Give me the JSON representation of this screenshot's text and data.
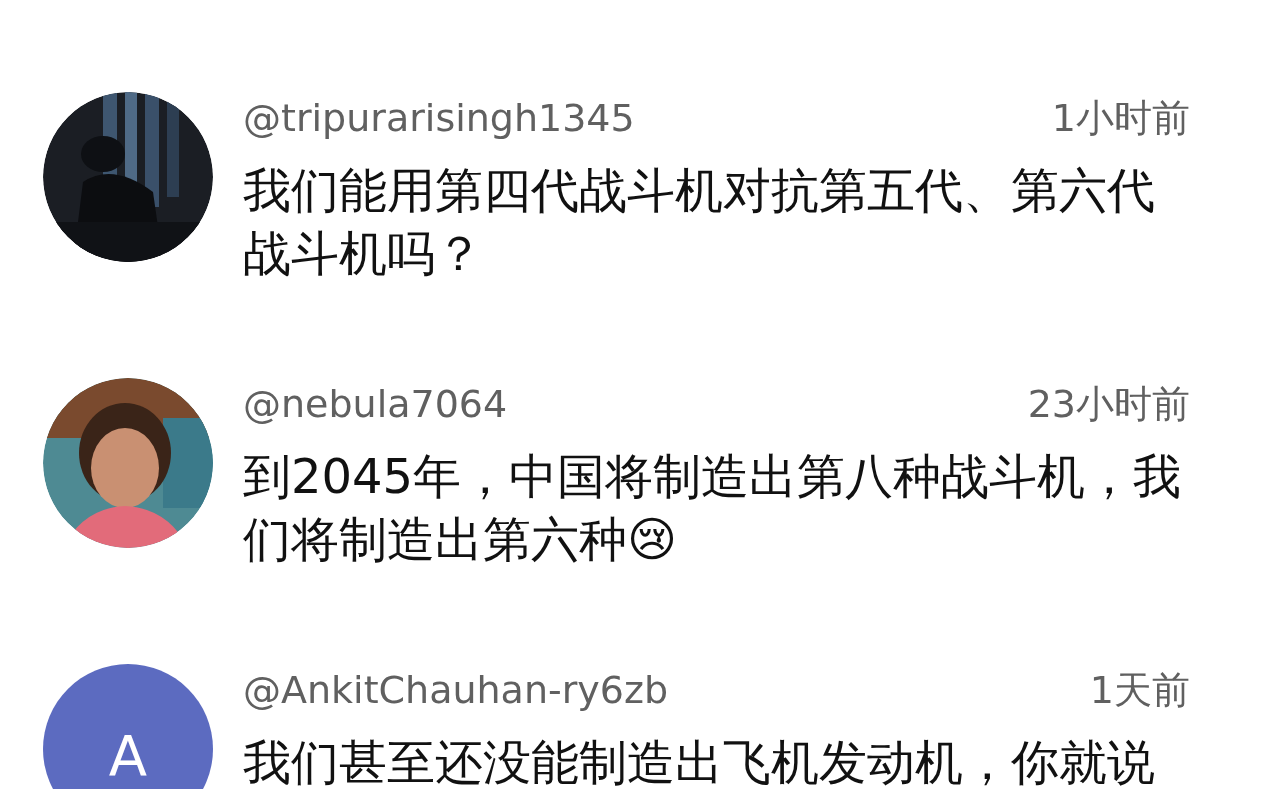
{
  "comments": [
    {
      "author": "@tripurarisingh1345",
      "time": "1小时前",
      "text": "我们能用第四代战斗机对抗第五代、第六代战斗机吗？"
    },
    {
      "author": "@nebula7064",
      "time": "23小时前",
      "text": "到2045年，中国将制造出第八种战斗机，我们将制造出第六种😢"
    },
    {
      "avatar": {
        "kind": "letter",
        "letter": "A",
        "color": "#5c6bc0"
      },
      "author": "@AnkitChauhan-ry6zb",
      "time": "1天前",
      "text": "我们甚至还没能制造出飞机发动机，你就说"
    }
  ]
}
